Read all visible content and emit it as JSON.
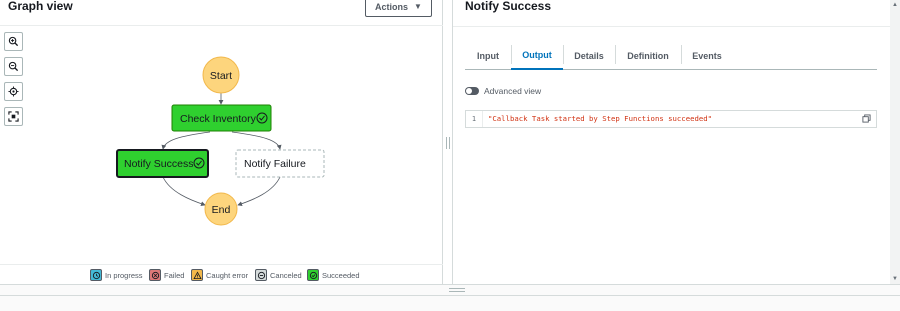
{
  "left_panel": {
    "title": "Graph view",
    "actions_label": "Actions",
    "zoom_controls": [
      "zoom-in-icon",
      "zoom-out-icon",
      "center-icon",
      "fit-icon"
    ]
  },
  "graph": {
    "nodes": {
      "start": "Start",
      "check_inventory": "Check Inventory",
      "notify_success": "Notify Success",
      "notify_failure": "Notify Failure",
      "end": "End"
    },
    "colors": {
      "succeeded": "#2fd02f",
      "start_end": "#fdd57d",
      "edge": "#545b64"
    }
  },
  "legend": {
    "in_progress": "In progress",
    "failed": "Failed",
    "caught_error": "Caught error",
    "canceled": "Canceled",
    "succeeded": "Succeeded"
  },
  "right_panel": {
    "title": "Notify Success",
    "tabs": [
      "Input",
      "Output",
      "Details",
      "Definition",
      "Events"
    ],
    "active_tab": "Output",
    "toggle_label": "Advanced view",
    "code_line_number": "1",
    "code_text": "\"Callback Task started by Step Functions succeeded\""
  }
}
